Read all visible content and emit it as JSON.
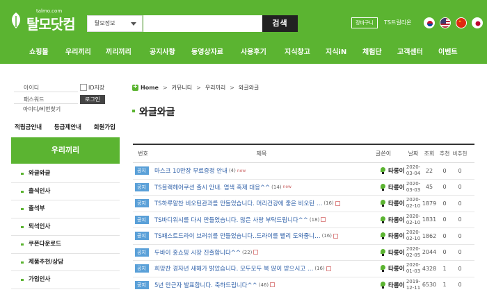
{
  "header": {
    "logo_text": "탈모닷컴",
    "logo_url": "talmo.com",
    "search_select": "탈모정보",
    "search_button": "검색",
    "cart_button": "장바구니",
    "family_link": "TS트릴리온"
  },
  "nav": {
    "items": [
      "쇼핑몰",
      "우리끼리",
      "끼리끼리",
      "공지사항",
      "동영상자료",
      "사용후기",
      "지식창고",
      "지식iN",
      "체험단",
      "고객센터",
      "이벤트"
    ]
  },
  "login": {
    "id_label": "아이디",
    "pw_label": "패스워드",
    "save_id": "ID저장",
    "login_button": "로그인",
    "find_link": "아이디/비번찾기"
  },
  "quick_links": [
    "적립금안내",
    "등급제안내",
    "회원가입"
  ],
  "sidebar": {
    "title": "우리끼리",
    "items": [
      "와글와글",
      "출석인사",
      "출석부",
      "퇴석인사",
      "쿠폰다운로드",
      "제품추천/상담",
      "가입인사"
    ]
  },
  "breadcrumb": {
    "home": "Home",
    "items": [
      "커뮤니티",
      "우리끼리",
      "와글와글"
    ]
  },
  "page_title": "와글와글",
  "board": {
    "headers": {
      "no": "번호",
      "subject": "제목",
      "author": "글쓴이",
      "date": "날짜",
      "views": "조회",
      "rec": "추천",
      "nrec": "비추천"
    },
    "rows": [
      {
        "badge": "공지",
        "subject": "마스크 10만장 무료증정 안내",
        "comments": "(4)",
        "new": "new",
        "attach": false,
        "author": "타롱이",
        "date1": "2020-",
        "date2": "03-04",
        "views": "22",
        "rec": "0",
        "nrec": "0"
      },
      {
        "badge": "공지",
        "subject": "TS블랙헤어쿠션 출시 안내. 염색 혹제 대응^^",
        "comments": "(14)",
        "new": "new",
        "attach": false,
        "author": "타롱이",
        "date1": "2020-",
        "date2": "03-03",
        "views": "45",
        "rec": "0",
        "nrec": "0"
      },
      {
        "badge": "공지",
        "subject": "TS하루알찬 비오틴관과를 만들었습니다. 머리건강에 좋은 비오틴 …",
        "comments": "(16)",
        "new": "",
        "attach": true,
        "author": "타롱이",
        "date1": "2020-",
        "date2": "02-10",
        "views": "1879",
        "rec": "0",
        "nrec": "0"
      },
      {
        "badge": "공지",
        "subject": "TS바디워시를 다시 만들었습니다. 많은 사랑 부탁드립니다^^",
        "comments": "(18)",
        "new": "",
        "attach": true,
        "author": "타롱이",
        "date1": "2020-",
        "date2": "02-10",
        "views": "1831",
        "rec": "0",
        "nrec": "0"
      },
      {
        "badge": "공지",
        "subject": "TS패스트드라이 브러쉬를 만들었습니다..드라이를 빨리 도와줍니…",
        "comments": "(16)",
        "new": "",
        "attach": true,
        "author": "타롱이",
        "date1": "2020-",
        "date2": "02-10",
        "views": "1862",
        "rec": "0",
        "nrec": "0"
      },
      {
        "badge": "공지",
        "subject": "두바이 홍쇼핑 시장 진출합니다^^",
        "comments": "(22)",
        "new": "",
        "attach": true,
        "author": "타롱이",
        "date1": "2020-",
        "date2": "02-05",
        "views": "2044",
        "rec": "0",
        "nrec": "0"
      },
      {
        "badge": "공지",
        "subject": "희망찬 경자년 새해가 밝았습니다. 모두모두 복 많이 받으시고 …",
        "comments": "(16)",
        "new": "",
        "attach": true,
        "author": "타롱이",
        "date1": "2020-",
        "date2": "01-03",
        "views": "4328",
        "rec": "1",
        "nrec": "0"
      },
      {
        "badge": "공지",
        "subject": "5년 만근자 발표합니다. 축하드립니다^^",
        "comments": "(46)",
        "new": "",
        "attach": true,
        "author": "타롱이",
        "date1": "2019-",
        "date2": "12-11",
        "views": "6530",
        "rec": "1",
        "nrec": "0"
      }
    ]
  },
  "colors": {
    "brand_green": "#5bb431",
    "notice_badge": "#5aa0d8",
    "subject_link": "#2d5fa8"
  }
}
